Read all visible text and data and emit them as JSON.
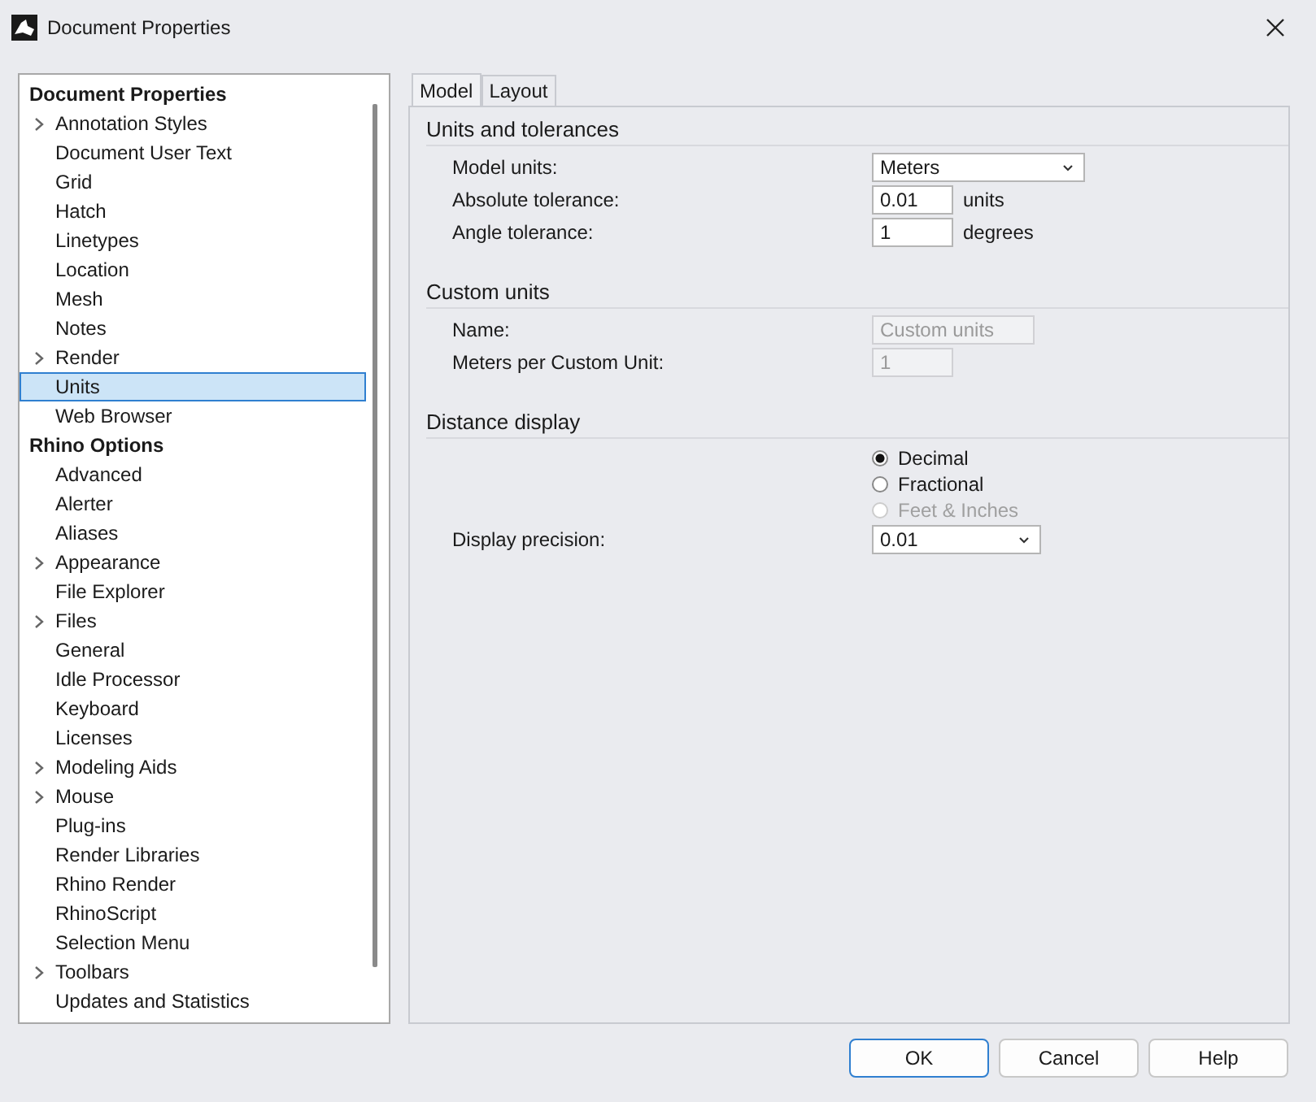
{
  "window": {
    "title": "Document Properties"
  },
  "tree": [
    {
      "label": "Document Properties",
      "kind": "header",
      "children": [
        {
          "label": "Annotation Styles",
          "expandable": true,
          "selected": false
        },
        {
          "label": "Document User Text",
          "expandable": false,
          "selected": false
        },
        {
          "label": "Grid",
          "expandable": false,
          "selected": false
        },
        {
          "label": "Hatch",
          "expandable": false,
          "selected": false
        },
        {
          "label": "Linetypes",
          "expandable": false,
          "selected": false
        },
        {
          "label": "Location",
          "expandable": false,
          "selected": false
        },
        {
          "label": "Mesh",
          "expandable": false,
          "selected": false
        },
        {
          "label": "Notes",
          "expandable": false,
          "selected": false
        },
        {
          "label": "Render",
          "expandable": true,
          "selected": false
        },
        {
          "label": "Units",
          "expandable": false,
          "selected": true
        },
        {
          "label": "Web Browser",
          "expandable": false,
          "selected": false
        }
      ]
    },
    {
      "label": "Rhino Options",
      "kind": "header",
      "children": [
        {
          "label": "Advanced",
          "expandable": false,
          "selected": false
        },
        {
          "label": "Alerter",
          "expandable": false,
          "selected": false
        },
        {
          "label": "Aliases",
          "expandable": false,
          "selected": false
        },
        {
          "label": "Appearance",
          "expandable": true,
          "selected": false
        },
        {
          "label": "File Explorer",
          "expandable": false,
          "selected": false
        },
        {
          "label": "Files",
          "expandable": true,
          "selected": false
        },
        {
          "label": "General",
          "expandable": false,
          "selected": false
        },
        {
          "label": "Idle Processor",
          "expandable": false,
          "selected": false
        },
        {
          "label": "Keyboard",
          "expandable": false,
          "selected": false
        },
        {
          "label": "Licenses",
          "expandable": false,
          "selected": false
        },
        {
          "label": "Modeling Aids",
          "expandable": true,
          "selected": false
        },
        {
          "label": "Mouse",
          "expandable": true,
          "selected": false
        },
        {
          "label": "Plug-ins",
          "expandable": false,
          "selected": false
        },
        {
          "label": "Render Libraries",
          "expandable": false,
          "selected": false
        },
        {
          "label": "Rhino Render",
          "expandable": false,
          "selected": false
        },
        {
          "label": "RhinoScript",
          "expandable": false,
          "selected": false
        },
        {
          "label": "Selection Menu",
          "expandable": false,
          "selected": false
        },
        {
          "label": "Toolbars",
          "expandable": true,
          "selected": false
        },
        {
          "label": "Updates and Statistics",
          "expandable": false,
          "selected": false
        }
      ]
    }
  ],
  "tabs": [
    {
      "label": "Model",
      "selected": true
    },
    {
      "label": "Layout",
      "selected": false
    }
  ],
  "sections": [
    {
      "title": "Units and tolerances",
      "rows": [
        {
          "kind": "dropdown",
          "label": "Model units:",
          "value": "Meters",
          "wide": true
        },
        {
          "kind": "field",
          "label": "Absolute tolerance:",
          "value": "0.01",
          "unit": "units",
          "disabled": false,
          "wide": false
        },
        {
          "kind": "field",
          "label": "Angle tolerance:",
          "value": "1",
          "unit": "degrees",
          "disabled": false,
          "wide": false
        }
      ]
    },
    {
      "title": "Custom units",
      "rows": [
        {
          "kind": "field",
          "label": "Name:",
          "value": "Custom units",
          "disabled": true,
          "wide": true
        },
        {
          "kind": "field",
          "label": "Meters per Custom Unit:",
          "value": "1",
          "disabled": true,
          "wide": false
        }
      ]
    },
    {
      "title": "Distance display",
      "rows": [
        {
          "kind": "radios",
          "options": [
            {
              "label": "Decimal",
              "selected": true,
              "disabled": false
            },
            {
              "label": "Fractional",
              "selected": false,
              "disabled": false
            },
            {
              "label": "Feet & Inches",
              "selected": false,
              "disabled": true
            }
          ]
        },
        {
          "kind": "dropdown",
          "label": "Display precision:",
          "value": "0.01",
          "wide": false
        }
      ]
    }
  ],
  "buttons": [
    {
      "label": "OK",
      "default": true
    },
    {
      "label": "Cancel",
      "default": false
    },
    {
      "label": "Help",
      "default": false
    }
  ]
}
